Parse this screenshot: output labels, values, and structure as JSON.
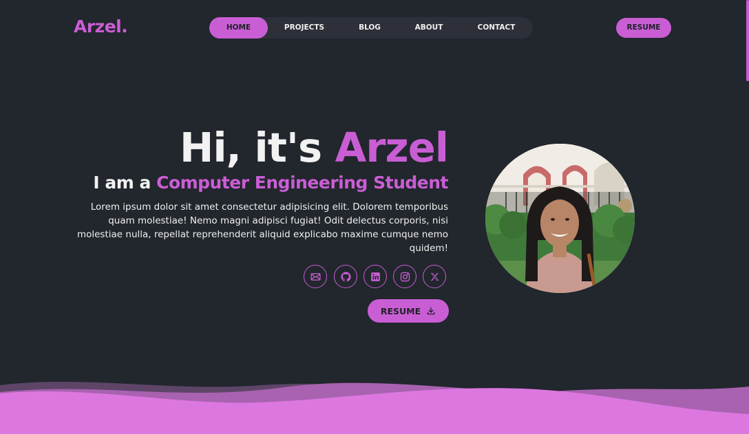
{
  "brand": {
    "logo": "Arzel."
  },
  "nav": {
    "items": [
      {
        "label": "HOME",
        "active": true
      },
      {
        "label": "PROJECTS",
        "active": false
      },
      {
        "label": "BLOG",
        "active": false
      },
      {
        "label": "ABOUT",
        "active": false
      },
      {
        "label": "CONTACT",
        "active": false
      }
    ],
    "resume_label": "RESUME"
  },
  "hero": {
    "greeting": "Hi, it's ",
    "name": "Arzel",
    "sub_prefix": "I am a ",
    "role": "Computer Engineering Student",
    "description": "Lorem ipsum dolor sit amet consectetur adipisicing elit. Dolorem temporibus quam molestiae! Nemo magni adipisci fugiat! Odit delectus corporis, nisi molestiae nulla, repellat reprehenderit aliquid explicabo maxime cumque nemo quidem!",
    "resume_label": "RESUME"
  },
  "socials": [
    {
      "icon": "mail-icon"
    },
    {
      "icon": "github-icon"
    },
    {
      "icon": "linkedin-icon"
    },
    {
      "icon": "instagram-icon"
    },
    {
      "icon": "x-icon"
    }
  ],
  "colors": {
    "background": "#22262d",
    "accent": "#c95ed4",
    "nav_bg": "#2d3038",
    "text": "#f2f2f2",
    "wave_light": "#dd77e0",
    "wave_mid": "#a862b0",
    "wave_dark": "#5e4568"
  }
}
